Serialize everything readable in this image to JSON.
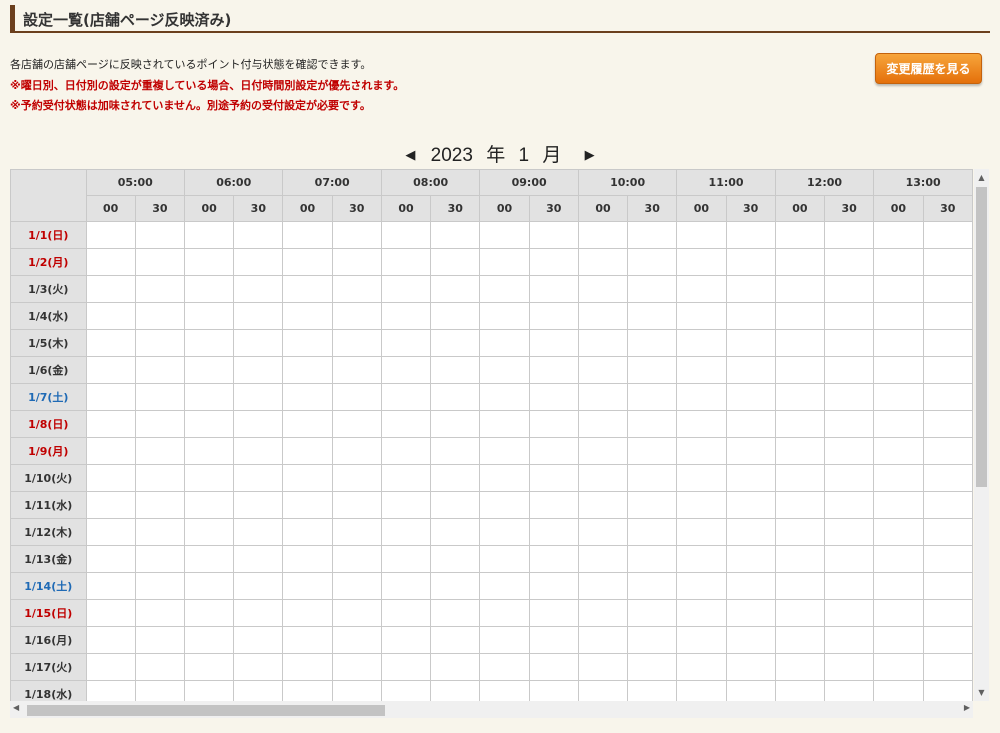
{
  "page": {
    "title": "設定一覧(店舗ページ反映済み)",
    "description": "各店舗の店舗ページに反映されているポイント付与状態を確認できます。",
    "warning1": "※曜日別、日付別の設定が重複している場合、日付時間別設定が優先されます。",
    "warning2": "※予約受付状態は加味されていません。別途予約の受付設定が必要です。",
    "history_button": "変更履歴を見る"
  },
  "calendar": {
    "year": "2023",
    "year_unit": "年",
    "month": "1",
    "month_unit": "月",
    "prev_icon": "◀",
    "next_icon": "▶"
  },
  "grid": {
    "hours": [
      "05:00",
      "06:00",
      "07:00",
      "08:00",
      "09:00",
      "10:00",
      "11:00",
      "12:00",
      "13:00"
    ],
    "halves": [
      "00",
      "30"
    ],
    "days": [
      {
        "label": "1/1(日)",
        "kind": "sun"
      },
      {
        "label": "1/2(月)",
        "kind": "sun"
      },
      {
        "label": "1/3(火)",
        "kind": "weekday"
      },
      {
        "label": "1/4(水)",
        "kind": "weekday"
      },
      {
        "label": "1/5(木)",
        "kind": "weekday"
      },
      {
        "label": "1/6(金)",
        "kind": "weekday"
      },
      {
        "label": "1/7(土)",
        "kind": "sat"
      },
      {
        "label": "1/8(日)",
        "kind": "sun"
      },
      {
        "label": "1/9(月)",
        "kind": "sun"
      },
      {
        "label": "1/10(火)",
        "kind": "weekday"
      },
      {
        "label": "1/11(水)",
        "kind": "weekday"
      },
      {
        "label": "1/12(木)",
        "kind": "weekday"
      },
      {
        "label": "1/13(金)",
        "kind": "weekday"
      },
      {
        "label": "1/14(土)",
        "kind": "sat"
      },
      {
        "label": "1/15(日)",
        "kind": "sun"
      },
      {
        "label": "1/16(月)",
        "kind": "weekday"
      },
      {
        "label": "1/17(火)",
        "kind": "weekday"
      },
      {
        "label": "1/18(水)",
        "kind": "weekday"
      }
    ]
  },
  "colors": {
    "sunday_holiday": "#c00000",
    "saturday": "#1f6ab5",
    "header_bg": "#e2e2e2",
    "button_orange": "#f08a1e",
    "title_accent": "#6b3f1d"
  }
}
